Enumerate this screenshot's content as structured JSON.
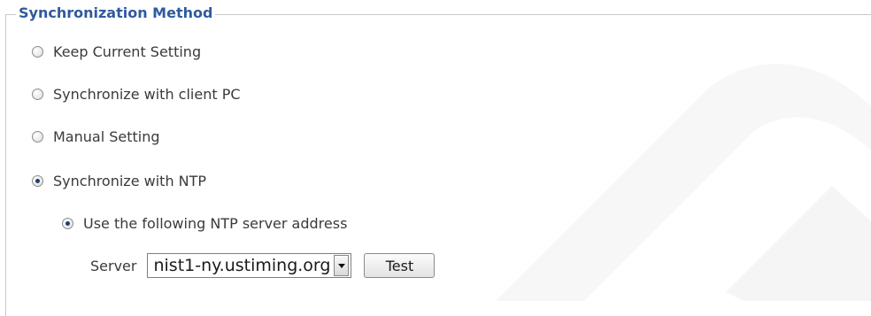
{
  "section": {
    "legend": "Synchronization Method"
  },
  "options": {
    "keep_current": {
      "label": "Keep Current Setting",
      "checked": false
    },
    "sync_client_pc": {
      "label": "Synchronize with client PC",
      "checked": false
    },
    "manual": {
      "label": "Manual Setting",
      "checked": false
    },
    "sync_ntp": {
      "label": "Synchronize with NTP",
      "checked": true
    }
  },
  "ntp": {
    "use_following": {
      "label": "Use the following NTP server address",
      "checked": true
    },
    "server_label": "Server",
    "server_value": "nist1-ny.ustiming.org",
    "test_button": "Test"
  },
  "colors": {
    "legend": "#2f5a9e",
    "text": "#3a3a3a",
    "border": "#c9c9c9"
  }
}
